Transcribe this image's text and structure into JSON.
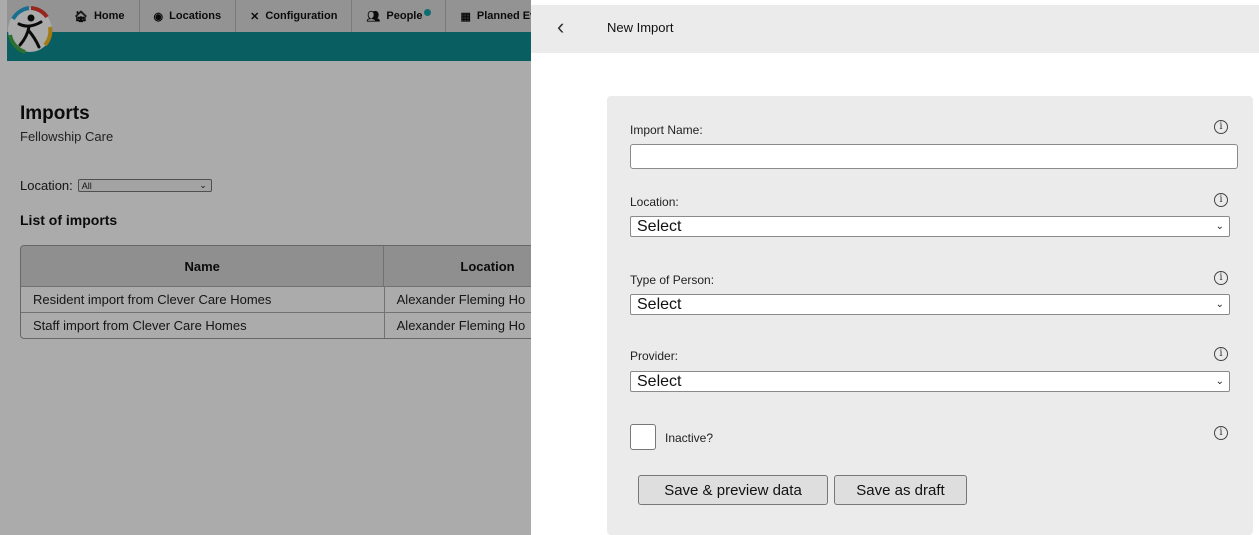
{
  "nav": {
    "items": [
      {
        "icon": "home-icon",
        "glyph": "🏠︎",
        "label": "Home"
      },
      {
        "icon": "compass-icon",
        "glyph": "◉",
        "label": "Locations"
      },
      {
        "icon": "tools-icon",
        "glyph": "✕",
        "label": "Configuration"
      },
      {
        "icon": "users-icon",
        "glyph": "👥︎",
        "label": "People"
      },
      {
        "icon": "calendar-icon",
        "glyph": "▦",
        "label": "Planned Eve"
      }
    ]
  },
  "page": {
    "title": "Imports",
    "subtitle": "Fellowship Care",
    "location_label": "Location:",
    "location_value": "All",
    "list_title": "List of imports"
  },
  "table": {
    "headers": [
      "Name",
      "Location"
    ],
    "rows": [
      [
        "Resident import from Clever Care Homes",
        "Alexander Fleming Ho"
      ],
      [
        "Staff import from Clever Care Homes",
        "Alexander Fleming Ho"
      ]
    ]
  },
  "panel": {
    "back_glyph": "‹",
    "title": "New Import",
    "fields": {
      "import_name_label": "Import Name:",
      "import_name_value": "",
      "location_label": "Location:",
      "location_value": "Select",
      "type_label": "Type of Person:",
      "type_value": "Select",
      "provider_label": "Provider:",
      "provider_value": "Select",
      "inactive_label": "Inactive?"
    },
    "info_glyph": "i",
    "buttons": {
      "save_preview": "Save & preview data",
      "save_draft": "Save as draft"
    }
  },
  "colors": {
    "teal": "#0d8c8f",
    "dot": "#13a3a8"
  }
}
